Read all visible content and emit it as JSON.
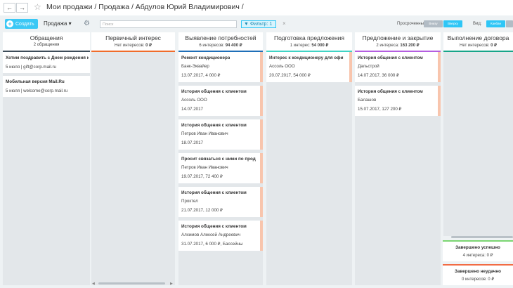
{
  "header": {
    "nav_back": "←",
    "nav_forward": "→",
    "breadcrumb": "Мои продажи / Продажа / Абдулов Юрий Владимирович /"
  },
  "toolbar": {
    "create_label": "Создать",
    "pipeline_label": "Продажа",
    "search_placeholder": "Поиск",
    "filter_label": "Фильтр: 1",
    "clear_label": "×",
    "overdue_label": "Просроченные:",
    "overdue_bottom": "Внизу",
    "overdue_top": "Вверху",
    "view_label": "Вид:",
    "view_kanban": "Канбан"
  },
  "columns": [
    {
      "title": "Обращения",
      "subtitle": "2 обращения",
      "color": "#3d4c59",
      "cards": [
        {
          "title": "Хотим поздравить с Днем рождения ко",
          "lines": [
            "5 июля | gift@corp.mail.ru"
          ]
        },
        {
          "title": "Мобильная версия Mail.Ru",
          "lines": [
            "5 июля | welcome@corp.mail.ru"
          ]
        }
      ]
    },
    {
      "title": "Первичный интерес",
      "subtitle_prefix": "Нет интересов:",
      "subtitle_value": "0 ₽",
      "color": "#f06c2b",
      "cards": []
    },
    {
      "title": "Выявление потребностей",
      "subtitle_prefix": "6 интересов:",
      "subtitle_value": "94 400 ₽",
      "color": "#1f6fb8",
      "cards": [
        {
          "title": "Ремонт кондиционера",
          "lines": [
            "Банк-Эквайер",
            "13.07.2017, 4 000 ₽"
          ]
        },
        {
          "title": "История общения с клиентом",
          "lines": [
            "Ассоль ООО",
            "14.07.2017"
          ]
        },
        {
          "title": "История общения с клиентом",
          "lines": [
            "Петров Иван Иванович",
            "18.07.2017"
          ]
        },
        {
          "title": "Просит связаться с ними по прод",
          "lines": [
            "Петров Иван Иванович",
            "19.07.2017, 72 400 ₽"
          ]
        },
        {
          "title": "История общения с клиентом",
          "lines": [
            "Проктел",
            "21.07.2017, 12 000 ₽"
          ]
        },
        {
          "title": "История общения с клиентом",
          "lines": [
            "Алхимов Алексей Андреевич",
            "31.07.2017, 6 000 ₽, Бассейны"
          ]
        }
      ]
    },
    {
      "title": "Подготовка предложения",
      "subtitle_prefix": "1 интерес:",
      "subtitle_value": "54 000 ₽",
      "color": "#40d3c5",
      "cards": [
        {
          "title": "Интерес к кондиционеру для офи",
          "lines": [
            "Ассоль ООО",
            "20.07.2017, 54 000 ₽"
          ]
        }
      ]
    },
    {
      "title": "Предложение и закрытие",
      "subtitle_prefix": "2 интереса:",
      "subtitle_value": "163 200 ₽",
      "color": "#b45ee0",
      "cards": [
        {
          "title": "История общения с клиентом",
          "lines": [
            "Дальстрой",
            "14.07.2017, 36 000 ₽"
          ]
        },
        {
          "title": "История общения с клиентом",
          "lines": [
            "Балашов",
            "15.07.2017, 127 200 ₽"
          ]
        }
      ]
    },
    {
      "title": "Выполнение договора",
      "subtitle_prefix": "Нет интересов:",
      "subtitle_value": "0 ₽",
      "color": "#17a589",
      "cards": []
    }
  ],
  "final_stages": [
    {
      "title": "Завершено успешно",
      "subtitle": "4 интереса: 0 ₽",
      "color": "#7bd672"
    },
    {
      "title": "Завершено неудачно",
      "subtitle": "0 интересов: 0 ₽",
      "color": "#f26c44"
    }
  ],
  "colors": {
    "accent": "#2fc6f6",
    "card_stripe": "#f8c5ad"
  }
}
